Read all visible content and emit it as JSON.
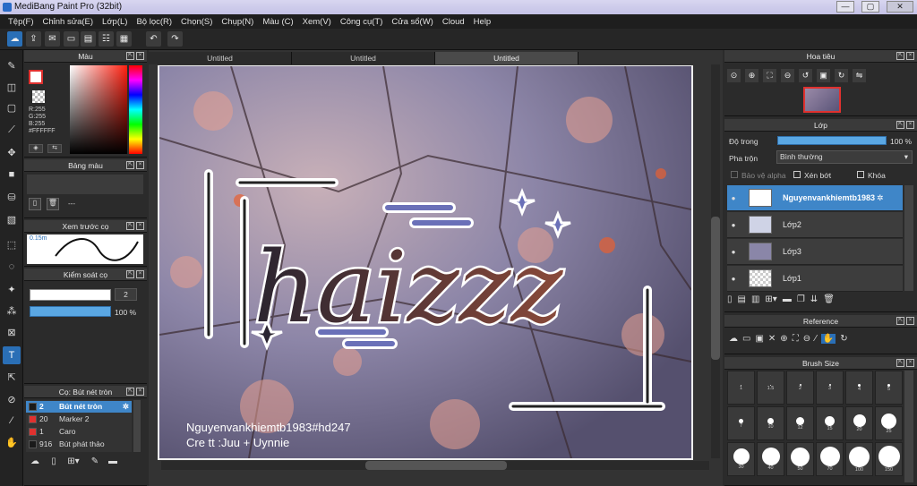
{
  "window": {
    "title": "MediBang Paint Pro (32bit)",
    "min": "—",
    "max": "▢",
    "close": "✕"
  },
  "menu": [
    "Tệp(F)",
    "Chỉnh sửa(E)",
    "Lớp(L)",
    "Bộ lọc(R)",
    "Chọn(S)",
    "Chụp(N)",
    "Màu (C)",
    "Xem(V)",
    "Công cụ(T)",
    "Cửa sổ(W)",
    "Cloud",
    "Help"
  ],
  "tabs": [
    "Untitled",
    "Untitled",
    "Untitled"
  ],
  "color_panel": {
    "title": "Màu",
    "r": "R:255",
    "g": "G:255",
    "b": "B:255",
    "hex": "#FFFFFF"
  },
  "palette_panel": {
    "title": "Bảng màu",
    "dash": "---"
  },
  "preview_panel": {
    "title": "Xem trước cọ",
    "size": "0.15m"
  },
  "control_panel": {
    "title": "Kiểm soát cọ",
    "size": "2",
    "opacity": "100 %"
  },
  "brush_panel": {
    "title": "Cọ: Bút nét tròn",
    "items": [
      {
        "size": "2",
        "name": "Bút nét tròn",
        "color": "#1a1a1a",
        "selected": true
      },
      {
        "size": "20",
        "name": "Marker 2",
        "color": "#e0312f",
        "selected": false
      },
      {
        "size": "1",
        "name": "Caro",
        "color": "#e0312f",
        "selected": false
      },
      {
        "size": "916",
        "name": "Bút phát thảo",
        "color": "#1a1a1a",
        "selected": false
      }
    ]
  },
  "navigator_panel": {
    "title": "Hoa tiêu"
  },
  "layer_panel": {
    "title": "Lớp",
    "opacity_label": "Độ trong",
    "opacity_value": "100 %",
    "blend_label": "Pha trộn",
    "blend_value": "Bình thường",
    "protect_alpha": "Bảo vệ alpha",
    "clipping": "Xén bớt",
    "lock": "Khóa",
    "layers": [
      {
        "name": "Nguyenvankhiemtb1983",
        "selected": true
      },
      {
        "name": "Lớp2",
        "selected": false
      },
      {
        "name": "Lớp3",
        "selected": false
      },
      {
        "name": "Lớp1",
        "selected": false
      }
    ]
  },
  "reference_panel": {
    "title": "Reference"
  },
  "brushsize_panel": {
    "title": "Brush Size",
    "sizes": [
      "1",
      "1.5",
      "2",
      "3",
      "4",
      "5",
      "7",
      "10",
      "12",
      "15",
      "20",
      "25",
      "30",
      "40",
      "50",
      "70",
      "100",
      "150"
    ]
  },
  "artwork": {
    "headline": "haizzz",
    "credit1": "Nguyenvankhiemtb1983#hd247",
    "credit2": "Cre tt :Juu + Uynnie"
  }
}
